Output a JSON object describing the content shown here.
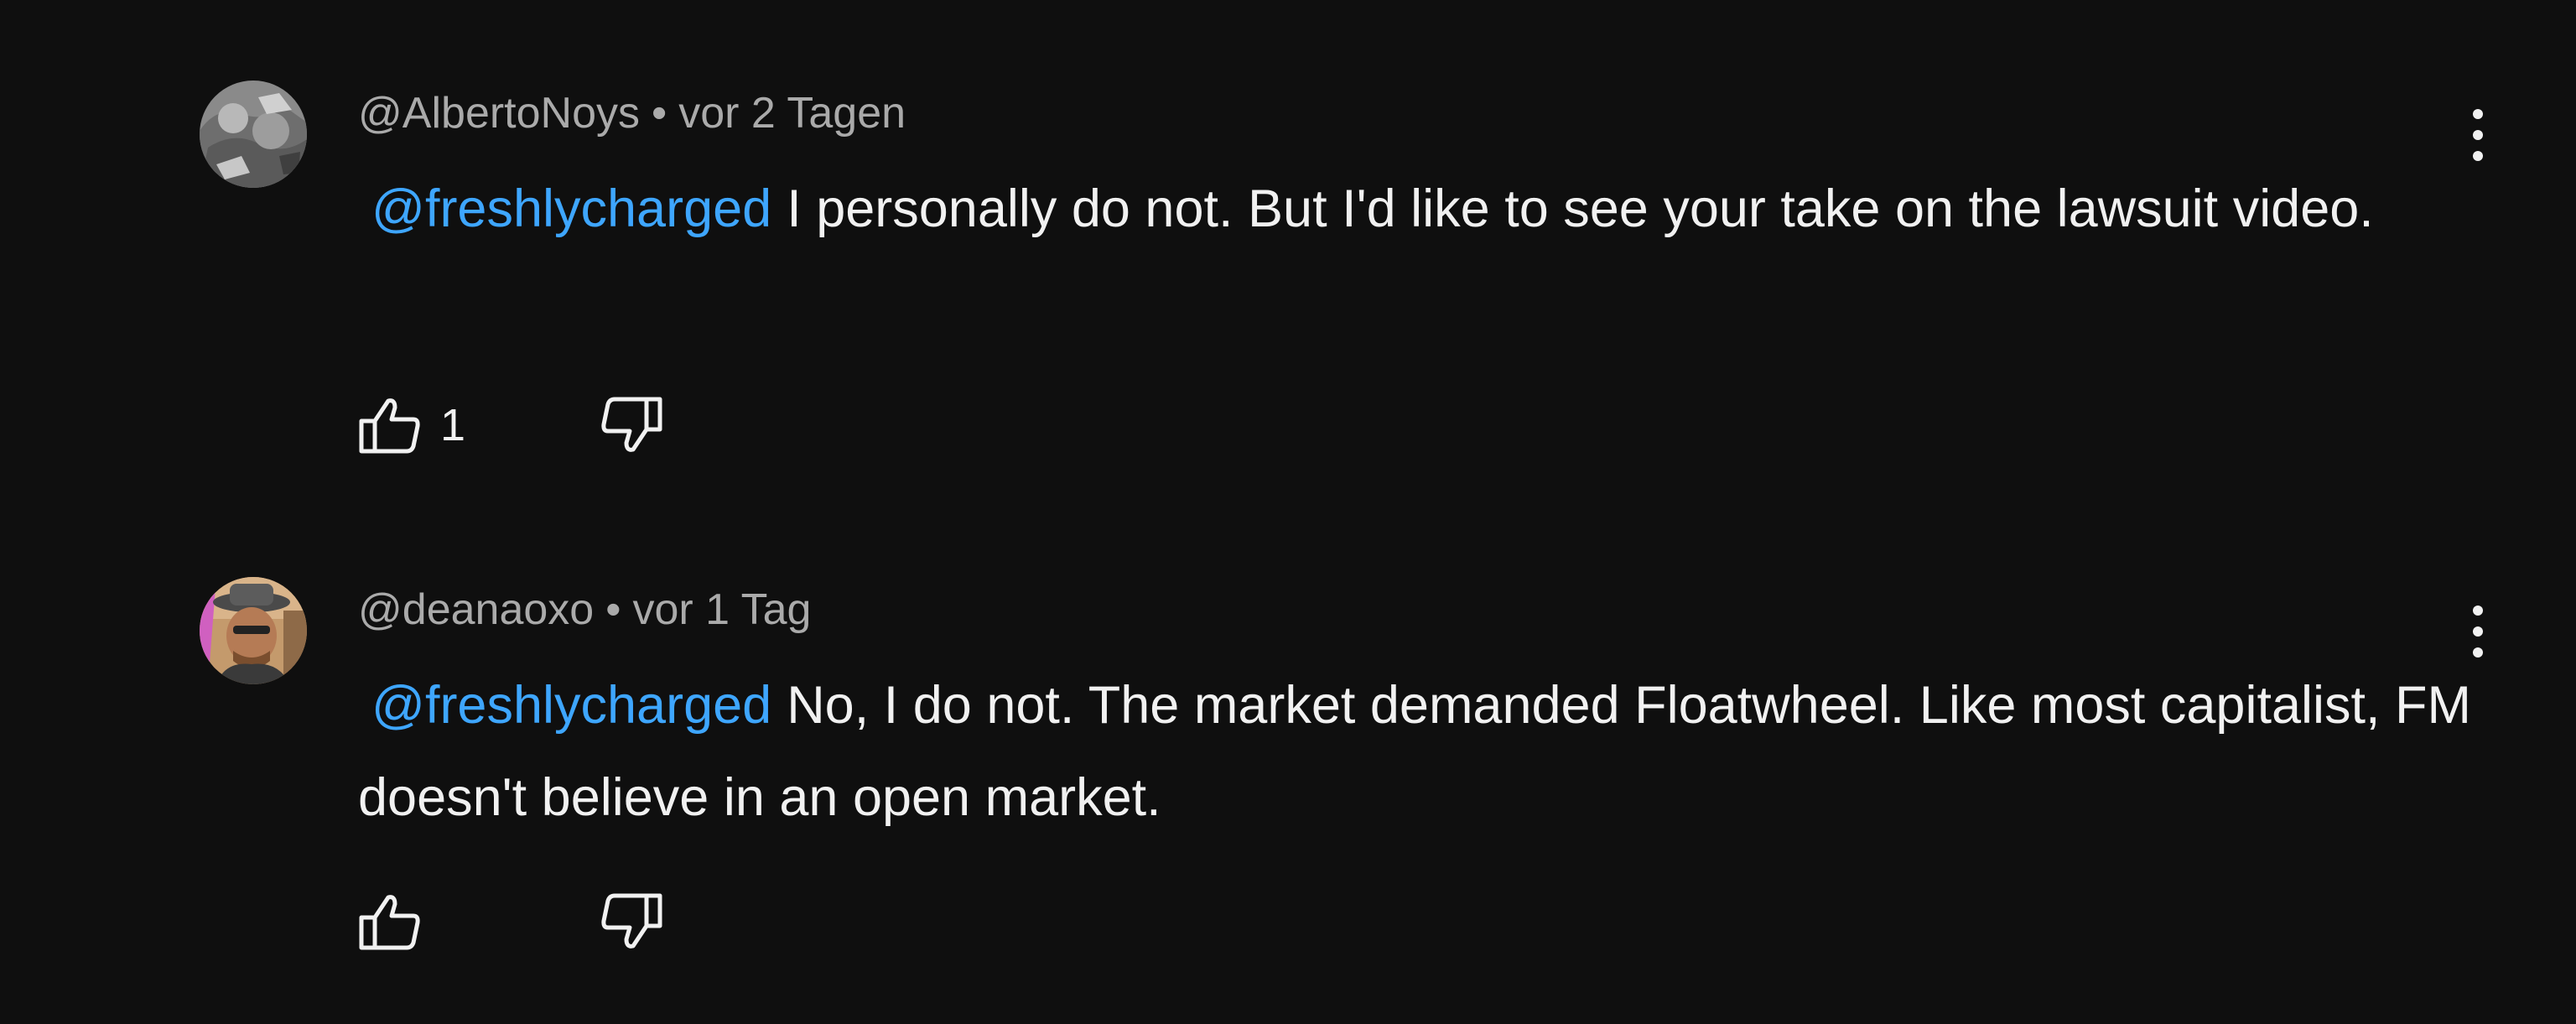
{
  "comments": [
    {
      "author": "@AlbertoNoys",
      "separator": "•",
      "time": "vor 2 Tagen",
      "mention": "@freshlycharged",
      "text": "I personally do not. But I'd like to see your take on the lawsuit video.",
      "like_count": "1",
      "avatar_icon": "rock-photo-avatar",
      "menu_icon": "more-vert-icon"
    },
    {
      "author": "@deanaoxo",
      "separator": "•",
      "time": "vor 1 Tag",
      "mention": "@freshlycharged",
      "text": "No, I do not. The market demanded Floatwheel. Like most capitalist, FM doesn't believe in an open market.",
      "like_count": "",
      "avatar_icon": "man-with-hat-photo-avatar",
      "menu_icon": "more-vert-icon"
    }
  ],
  "colors": {
    "background": "#0f0f0f",
    "text_primary": "#f1f1f1",
    "text_secondary": "#aaaaaa",
    "mention": "#3ea6ff"
  }
}
